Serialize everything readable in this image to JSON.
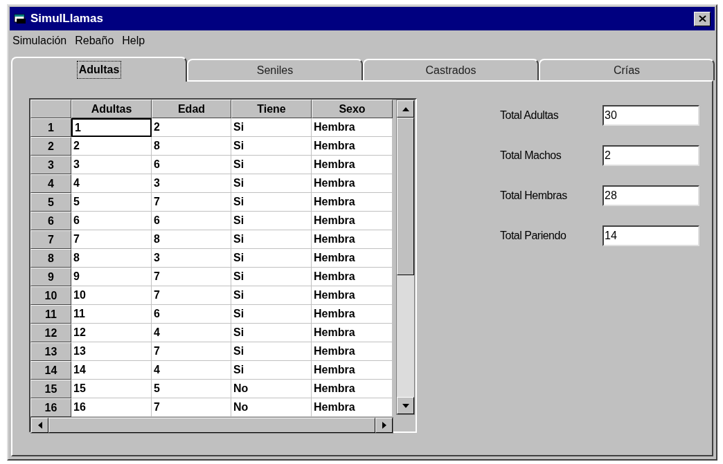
{
  "window": {
    "title": "SimulLlamas"
  },
  "menu": [
    "Simulación",
    "Rebaño",
    "Help"
  ],
  "tabs": [
    {
      "label": "Adultas",
      "selected": true
    },
    {
      "label": "Seniles",
      "selected": false
    },
    {
      "label": "Castrados",
      "selected": false
    },
    {
      "label": "Crías",
      "selected": false
    }
  ],
  "table": {
    "columns": [
      "Adultas",
      "Edad",
      "Tiene",
      "Sexo"
    ],
    "rows": [
      {
        "header": "1",
        "cells": [
          "1",
          "2",
          "Si",
          "Hembra"
        ],
        "focused": true
      },
      {
        "header": "2",
        "cells": [
          "2",
          "8",
          "Si",
          "Hembra"
        ],
        "focused": false
      },
      {
        "header": "3",
        "cells": [
          "3",
          "6",
          "Si",
          "Hembra"
        ],
        "focused": false
      },
      {
        "header": "4",
        "cells": [
          "4",
          "3",
          "Si",
          "Hembra"
        ],
        "focused": false
      },
      {
        "header": "5",
        "cells": [
          "5",
          "7",
          "Si",
          "Hembra"
        ],
        "focused": false
      },
      {
        "header": "6",
        "cells": [
          "6",
          "6",
          "Si",
          "Hembra"
        ],
        "focused": false
      },
      {
        "header": "7",
        "cells": [
          "7",
          "8",
          "Si",
          "Hembra"
        ],
        "focused": false
      },
      {
        "header": "8",
        "cells": [
          "8",
          "3",
          "Si",
          "Hembra"
        ],
        "focused": false
      },
      {
        "header": "9",
        "cells": [
          "9",
          "7",
          "Si",
          "Hembra"
        ],
        "focused": false
      },
      {
        "header": "10",
        "cells": [
          "10",
          "7",
          "Si",
          "Hembra"
        ],
        "focused": false
      },
      {
        "header": "11",
        "cells": [
          "11",
          "6",
          "Si",
          "Hembra"
        ],
        "focused": false
      },
      {
        "header": "12",
        "cells": [
          "12",
          "4",
          "Si",
          "Hembra"
        ],
        "focused": false
      },
      {
        "header": "13",
        "cells": [
          "13",
          "7",
          "Si",
          "Hembra"
        ],
        "focused": false
      },
      {
        "header": "14",
        "cells": [
          "14",
          "4",
          "Si",
          "Hembra"
        ],
        "focused": false
      },
      {
        "header": "15",
        "cells": [
          "15",
          "5",
          "No",
          "Hembra"
        ],
        "focused": false
      },
      {
        "header": "16",
        "cells": [
          "16",
          "7",
          "No",
          "Hembra"
        ],
        "focused": false
      }
    ]
  },
  "totals": [
    {
      "label": "Total Adultas",
      "value": "30"
    },
    {
      "label": "Total Machos",
      "value": "2"
    },
    {
      "label": "Total Hembras",
      "value": "28"
    },
    {
      "label": "Total Pariendo",
      "value": "14"
    }
  ]
}
